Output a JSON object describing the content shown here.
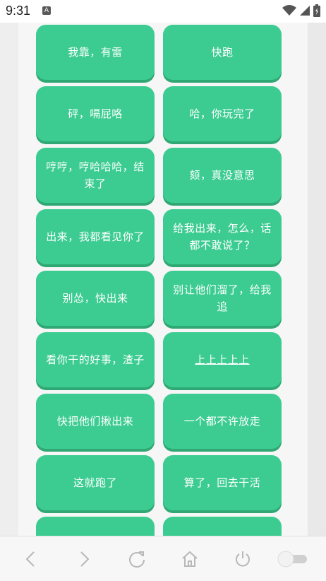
{
  "status": {
    "time": "9:31",
    "app_badge": "A"
  },
  "buttons": [
    {
      "label": "我靠，有雷"
    },
    {
      "label": "快跑"
    },
    {
      "label": "砰，嗝屁咯"
    },
    {
      "label": "哈，你玩完了"
    },
    {
      "label": "哼哼，哼哈哈哈，结束了"
    },
    {
      "label": "颏，真没意思"
    },
    {
      "label": "出来，我都看见你了"
    },
    {
      "label": "给我出来，怎么，话都不敢说了？"
    },
    {
      "label": "别怂，快出来"
    },
    {
      "label": "别让他们溜了，给我追"
    },
    {
      "label": "看你干的好事，渣子"
    },
    {
      "label": "上上上上上"
    },
    {
      "label": "快把他们揪出来"
    },
    {
      "label": "一个都不许放走"
    },
    {
      "label": "这就跑了"
    },
    {
      "label": "算了，回去干活"
    },
    {
      "label": ""
    },
    {
      "label": ""
    }
  ],
  "nav": {
    "icons": [
      "back-icon",
      "forward-icon",
      "refresh-icon",
      "home-icon",
      "power-icon",
      "toggle-switch"
    ]
  },
  "colors": {
    "button": "#3ccc91",
    "button_shadow": "#2fa874"
  }
}
